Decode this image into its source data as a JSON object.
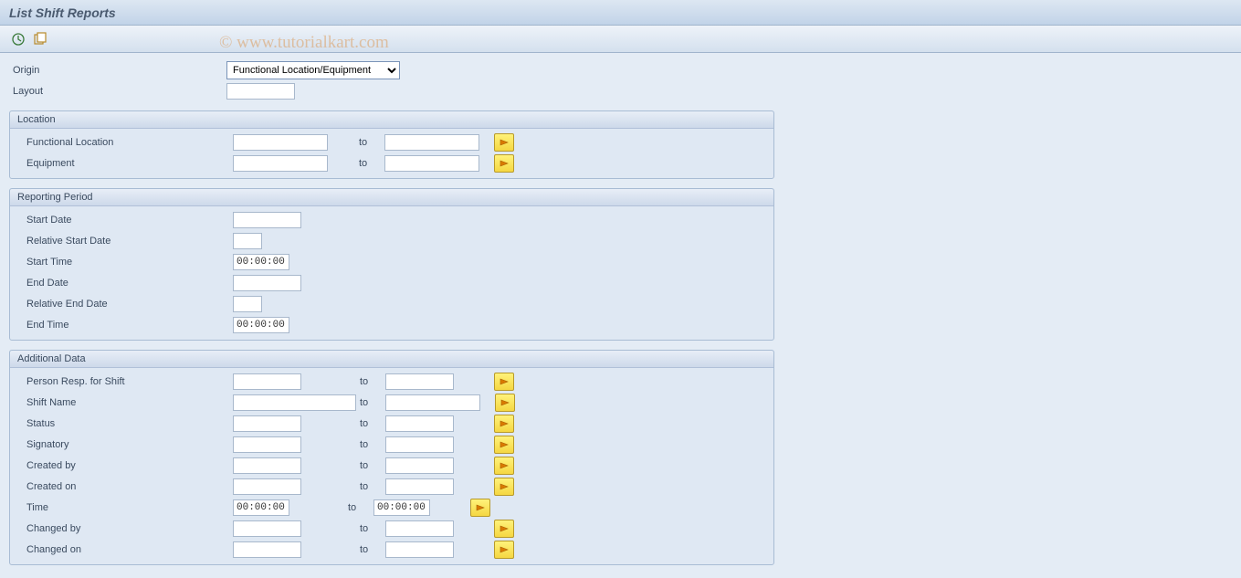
{
  "header": {
    "title": "List Shift Reports"
  },
  "watermark": "© www.tutorialkart.com",
  "top": {
    "origin_label": "Origin",
    "origin_value": "Functional Location/Equipment",
    "layout_label": "Layout",
    "layout_value": ""
  },
  "to_label": "to",
  "groups": {
    "location": {
      "title": "Location",
      "rows": [
        {
          "label": "Functional Location",
          "from": "",
          "to": ""
        },
        {
          "label": "Equipment",
          "from": "",
          "to": ""
        }
      ]
    },
    "reporting": {
      "title": "Reporting Period",
      "start_date_label": "Start Date",
      "start_date": "",
      "rel_start_label": "Relative Start Date",
      "rel_start": "",
      "start_time_label": "Start Time",
      "start_time": "00:00:00",
      "end_date_label": "End Date",
      "end_date": "",
      "rel_end_label": "Relative End Date",
      "rel_end": "",
      "end_time_label": "End Time",
      "end_time": "00:00:00"
    },
    "additional": {
      "title": "Additional Data",
      "rows": [
        {
          "label": "Person Resp. for Shift",
          "from": "",
          "to": "",
          "wide_from": false
        },
        {
          "label": "Shift Name",
          "from": "",
          "to": "",
          "wide_from": true,
          "wide_to": true
        },
        {
          "label": "Status",
          "from": "",
          "to": ""
        },
        {
          "label": "Signatory",
          "from": "",
          "to": ""
        },
        {
          "label": "Created by",
          "from": "",
          "to": ""
        },
        {
          "label": "Created on",
          "from": "",
          "to": ""
        },
        {
          "label": "Time",
          "from": "00:00:00",
          "to": "00:00:00",
          "time": true
        },
        {
          "label": "Changed by",
          "from": "",
          "to": ""
        },
        {
          "label": "Changed on",
          "from": "",
          "to": ""
        }
      ]
    }
  }
}
